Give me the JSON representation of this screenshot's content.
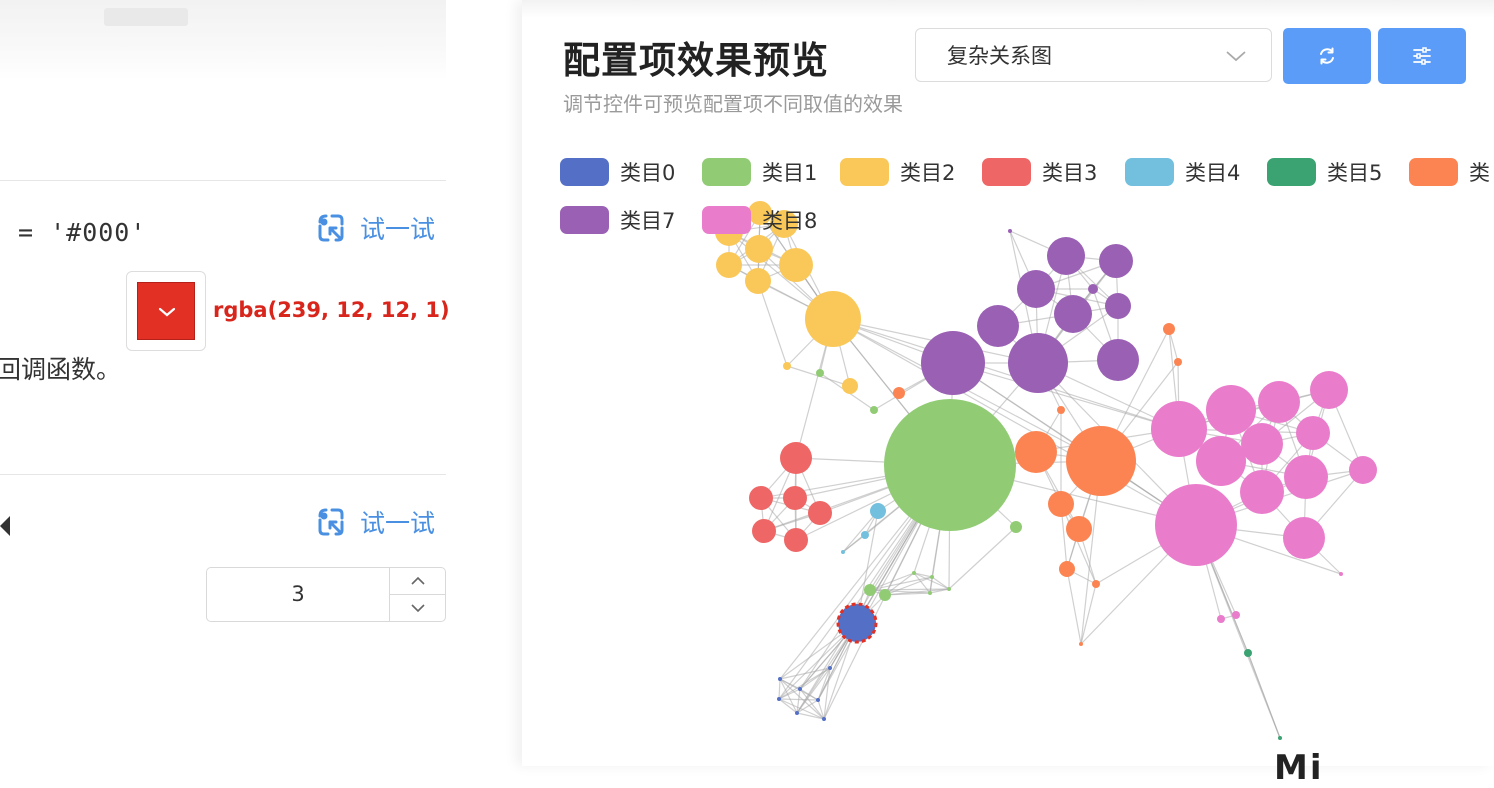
{
  "left": {
    "code_text": "= '#000'",
    "try_label_1": "试一试",
    "try_label_2": "试一试",
    "color_value": "rgba(239, 12, 12, 1)",
    "callback_text": "回调函数。",
    "stepper_value": "3"
  },
  "right": {
    "title": "配置项效果预览",
    "subtitle": "调节控件可预览配置项不同取值的效果",
    "select_value": "复杂关系图",
    "bottom_text": "Mi",
    "refresh_icon": "refresh-icon",
    "settings_icon": "sliders-icon"
  },
  "chart_data": {
    "type": "graph",
    "legend": [
      {
        "name": "类目0",
        "color": "#5470c6"
      },
      {
        "name": "类目1",
        "color": "#91cc75"
      },
      {
        "name": "类目2",
        "color": "#fac858"
      },
      {
        "name": "类目3",
        "color": "#ee6666"
      },
      {
        "name": "类目4",
        "color": "#73c0de"
      },
      {
        "name": "类目5",
        "color": "#3ba272"
      },
      {
        "name": "类",
        "color": "#fc8452"
      },
      {
        "name": "类目7",
        "color": "#9a60b4"
      },
      {
        "name": "类目8",
        "color": "#ea7ccc"
      }
    ],
    "selected_node_border_color": "#e23024"
  }
}
